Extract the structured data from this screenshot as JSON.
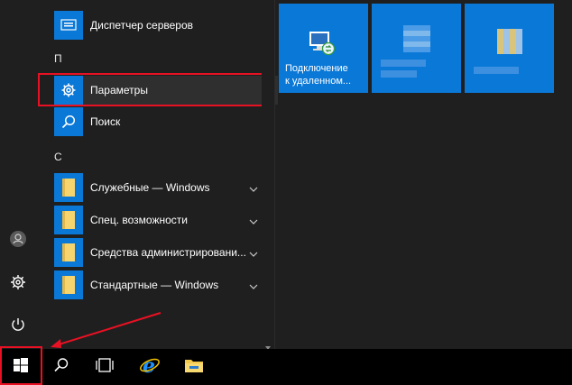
{
  "app_list": {
    "top_app": {
      "label": "Диспетчер серверов",
      "icon": "server-manager-icon"
    },
    "groups": [
      {
        "letter": "П",
        "apps": [
          {
            "label": "Параметры",
            "icon": "gear-icon",
            "selected": true
          }
        ]
      },
      {
        "letter": "",
        "apps": [
          {
            "label": "Поиск",
            "icon": "search-icon"
          }
        ]
      },
      {
        "letter": "С",
        "apps": [
          {
            "label": "Служебные — Windows",
            "icon": "folder-icon",
            "expandable": true
          },
          {
            "label": "Спец. возможности",
            "icon": "folder-icon",
            "expandable": true
          },
          {
            "label": "Средства администрировани...",
            "icon": "folder-icon",
            "expandable": true
          },
          {
            "label": "Стандартные — Windows",
            "icon": "folder-icon",
            "expandable": true
          }
        ]
      }
    ]
  },
  "tiles": [
    {
      "label_line1": "Подключение",
      "label_line2": "к удаленном...",
      "icon": "remote-desktop-icon"
    },
    {
      "label_line1": "",
      "label_line2": "",
      "icon": "blurred-app-icon"
    },
    {
      "label_line1": "",
      "label_line2": "",
      "icon": "blurred-app-icon"
    }
  ],
  "rail": [
    "user-icon",
    "settings-icon",
    "power-icon"
  ],
  "taskbar": [
    "windows-start-icon",
    "search-icon",
    "task-view-icon",
    "internet-explorer-icon",
    "file-explorer-icon"
  ],
  "colors": {
    "accent": "#0a78d7",
    "highlight": "#e81123",
    "menu_bg": "#1f1f1f",
    "taskbar_bg": "#000000"
  }
}
